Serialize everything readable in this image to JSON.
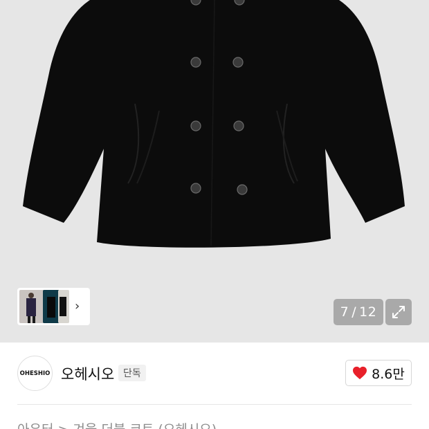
{
  "gallery": {
    "current": "7",
    "separator": "/",
    "total": "12",
    "thumbnails": [
      "thumbnail-model-front",
      "thumbnail-model-dark",
      "thumbnail-model-side"
    ]
  },
  "brand": {
    "logo_text": "OHESHIO",
    "name": "오헤시오",
    "badge": "단독"
  },
  "like": {
    "count": "8.6만",
    "color": "#e8202a"
  },
  "breadcrumb": {
    "text": "아우터 > 겨울 더블 코트 (오헤시오)"
  },
  "colors": {
    "hero_background": "#e6e6e6",
    "counter_background": "#a9a9a9",
    "coat": "#0c0c0c"
  }
}
